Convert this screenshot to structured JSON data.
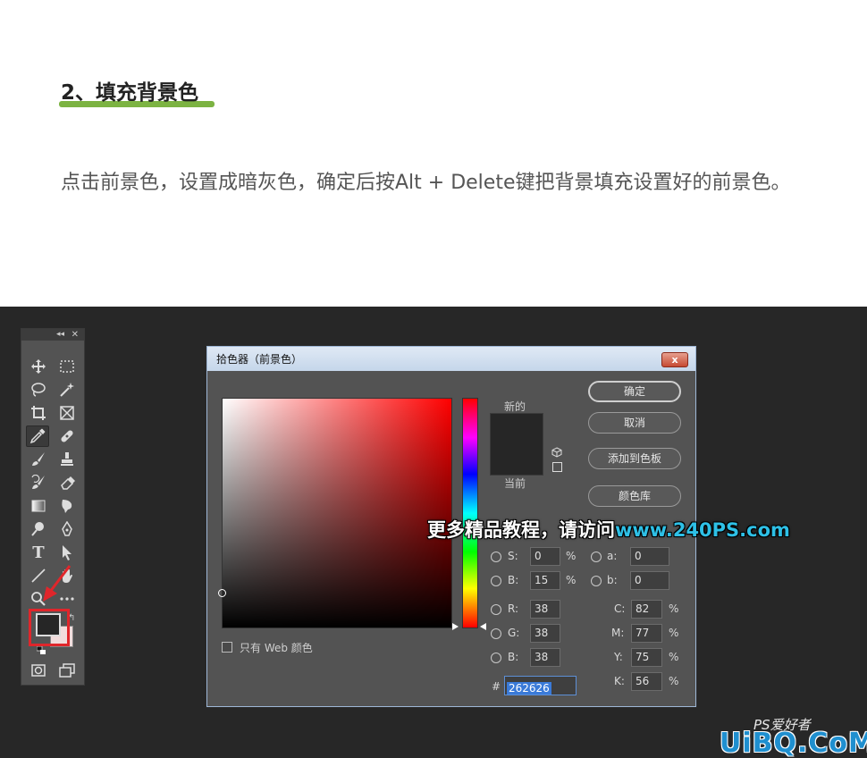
{
  "article": {
    "heading": "2、填充背景色",
    "paragraph": "点击前景色，设置成暗灰色，确定后按Alt + Delete键把背景填充设置好的前景色。"
  },
  "colors": {
    "accent_underline": "#7cb342",
    "foreground_color": "#262626",
    "highlight_red": "#e0262b",
    "promo_site": "#2ec0e6"
  },
  "toolbox": {
    "collapse_icon": "double-chevron-icon",
    "close_icon": "close-icon",
    "text_tool": "T"
  },
  "dialog": {
    "title": "拾色器（前景色）",
    "close_label": "x",
    "new_label": "新的",
    "current_label": "当前",
    "buttons": {
      "ok": "确定",
      "cancel": "取消",
      "add_to_swatches": "添加到色板",
      "color_libraries": "颜色库"
    },
    "fields": {
      "S": {
        "label": "S:",
        "value": "0",
        "unit": "%"
      },
      "B": {
        "label": "B:",
        "value": "15",
        "unit": "%"
      },
      "a": {
        "label": "a:",
        "value": "0"
      },
      "b": {
        "label": "b:",
        "value": "0"
      },
      "R": {
        "label": "R:",
        "value": "38"
      },
      "G": {
        "label": "G:",
        "value": "38"
      },
      "Bl": {
        "label": "B:",
        "value": "38"
      },
      "C": {
        "label": "C:",
        "value": "82",
        "unit": "%"
      },
      "M": {
        "label": "M:",
        "value": "77",
        "unit": "%"
      },
      "Y": {
        "label": "Y:",
        "value": "75",
        "unit": "%"
      },
      "K": {
        "label": "K:",
        "value": "56",
        "unit": "%"
      }
    },
    "hex_label": "#",
    "hex_value": "262626",
    "web_only_label": "只有 Web 颜色"
  },
  "overlay": {
    "promo_text": "更多精品教程，请访问",
    "promo_site": "www.240PS.com",
    "logo_small": "PS爱好者",
    "logo_big": "UiBQ.CoM"
  }
}
